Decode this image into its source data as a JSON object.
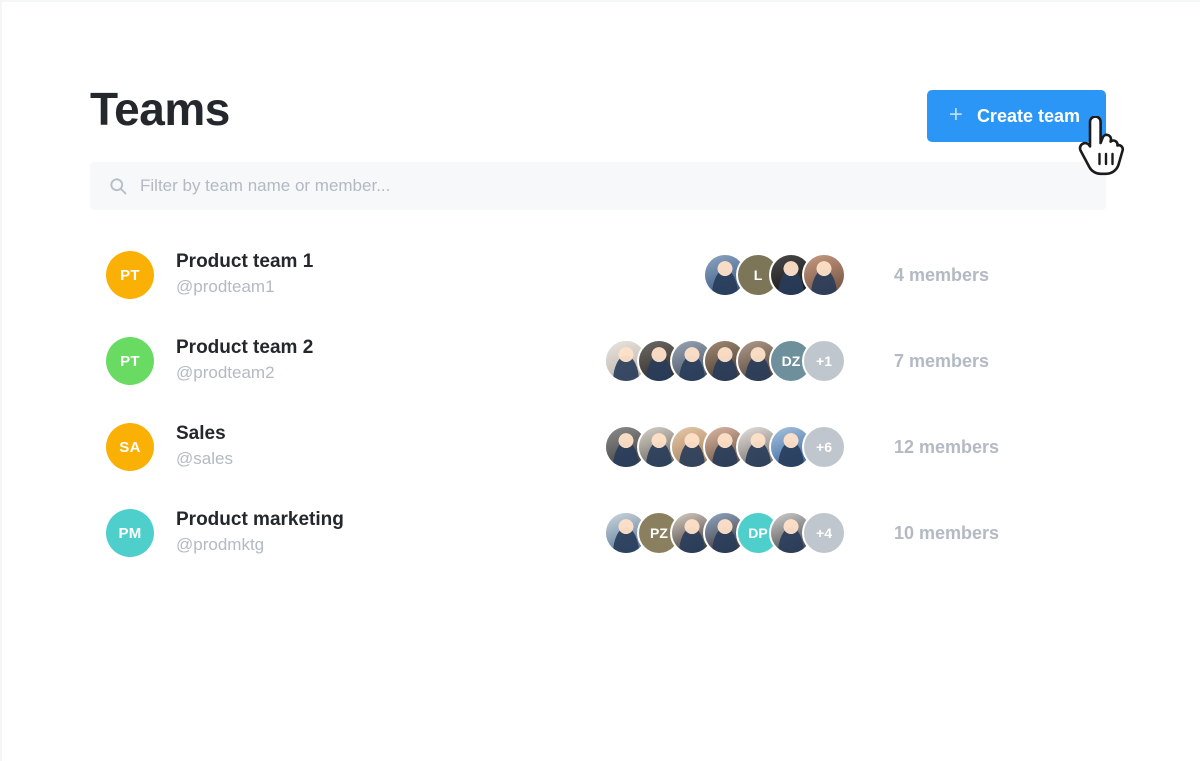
{
  "header": {
    "title": "Teams",
    "create_button_label": "Create team",
    "create_button_icon": "plus-icon",
    "accent_color": "#2b96f6"
  },
  "search": {
    "icon": "search-icon",
    "placeholder": "Filter by team name or member...",
    "value": ""
  },
  "cursor": {
    "icon": "hand-pointer-cursor"
  },
  "teams": [
    {
      "name": "Product team 1",
      "handle": "@prodteam1",
      "initials": "PT",
      "color": "#fab005",
      "member_count_label": "4 members",
      "members": [
        {
          "type": "photo",
          "c1": "#8fa6c4",
          "c2": "#2f4f77",
          "initials": ""
        },
        {
          "type": "initials",
          "color": "#7d7558",
          "initials": "L"
        },
        {
          "type": "photo",
          "c1": "#4a4a4a",
          "c2": "#111111",
          "initials": ""
        },
        {
          "type": "photo",
          "c1": "#c89a82",
          "c2": "#6b4c3a",
          "initials": ""
        }
      ],
      "overflow_label": ""
    },
    {
      "name": "Product team 2",
      "handle": "@prodteam2",
      "initials": "PT",
      "color": "#69db63",
      "member_count_label": "7 members",
      "members": [
        {
          "type": "photo",
          "c1": "#e8e4e0",
          "c2": "#b9aea4",
          "initials": ""
        },
        {
          "type": "photo",
          "c1": "#6e6a66",
          "c2": "#2a2724",
          "initials": ""
        },
        {
          "type": "photo",
          "c1": "#9aa6b4",
          "c2": "#3d4a5c",
          "initials": ""
        },
        {
          "type": "photo",
          "c1": "#a08a74",
          "c2": "#3f3228",
          "initials": ""
        },
        {
          "type": "photo",
          "c1": "#b09c8c",
          "c2": "#4a3a30",
          "initials": ""
        },
        {
          "type": "initials",
          "color": "#6d909c",
          "initials": "DZ"
        }
      ],
      "overflow_label": "+1"
    },
    {
      "name": "Sales",
      "handle": "@sales",
      "initials": "SA",
      "color": "#fab005",
      "member_count_label": "12 members",
      "members": [
        {
          "type": "photo",
          "c1": "#8c8c8c",
          "c2": "#3b3b3b",
          "initials": ""
        },
        {
          "type": "photo",
          "c1": "#d8d4cc",
          "c2": "#5b574f",
          "initials": ""
        },
        {
          "type": "photo",
          "c1": "#e8c9a8",
          "c2": "#9b7a56",
          "initials": ""
        },
        {
          "type": "photo",
          "c1": "#ddb9a4",
          "c2": "#5d4436",
          "initials": ""
        },
        {
          "type": "photo",
          "c1": "#e6e2de",
          "c2": "#6b635c",
          "initials": ""
        },
        {
          "type": "photo",
          "c1": "#a9c4e0",
          "c2": "#2f5e96",
          "initials": ""
        }
      ],
      "overflow_label": "+6"
    },
    {
      "name": "Product marketing",
      "handle": "@prodmktg",
      "initials": "PM",
      "color": "#4fcfcb",
      "member_count_label": "10 members",
      "members": [
        {
          "type": "photo",
          "c1": "#cfd8df",
          "c2": "#4a6c8e",
          "initials": ""
        },
        {
          "type": "initials",
          "color": "#8a7f5f",
          "initials": "PZ"
        },
        {
          "type": "photo",
          "c1": "#d9cec4",
          "c2": "#2e2b28",
          "initials": ""
        },
        {
          "type": "photo",
          "c1": "#8fa8c6",
          "c2": "#3a2b26",
          "initials": ""
        },
        {
          "type": "initials",
          "color": "#4fcfcb",
          "initials": "DP"
        },
        {
          "type": "photo",
          "c1": "#cfcfcf",
          "c2": "#3a3a3a",
          "initials": ""
        }
      ],
      "overflow_label": "+4"
    }
  ]
}
